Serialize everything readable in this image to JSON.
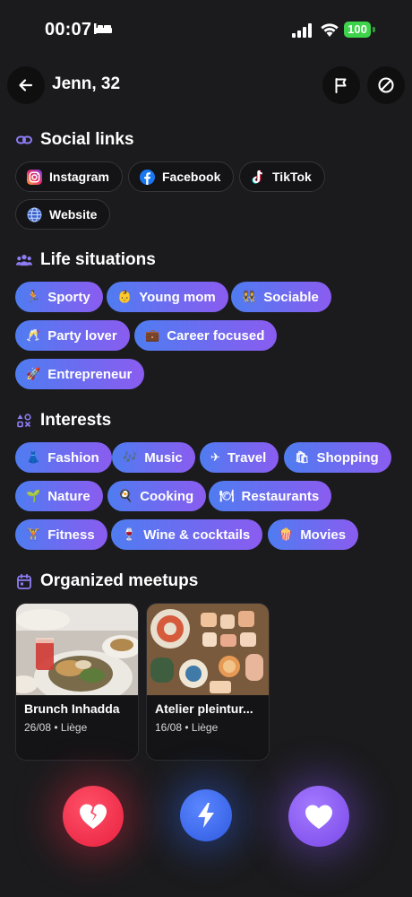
{
  "status_bar": {
    "time": "00:07",
    "battery": "100"
  },
  "header": {
    "title": "Jenn, 32"
  },
  "social_links": {
    "title": "Social links",
    "items": [
      {
        "label": "Instagram",
        "icon": "instagram-icon"
      },
      {
        "label": "Facebook",
        "icon": "facebook-icon"
      },
      {
        "label": "TikTok",
        "icon": "tiktok-icon"
      },
      {
        "label": "Website",
        "icon": "globe-icon"
      }
    ]
  },
  "life_situations": {
    "title": "Life situations",
    "items": [
      {
        "emoji": "🏃",
        "label": "Sporty"
      },
      {
        "emoji": "👶",
        "label": "Young mom"
      },
      {
        "emoji": "👯",
        "label": "Sociable"
      },
      {
        "emoji": "🥂",
        "label": "Party lover"
      },
      {
        "emoji": "💼",
        "label": "Career focused"
      },
      {
        "emoji": "🚀",
        "label": "Entrepreneur"
      }
    ]
  },
  "interests": {
    "title": "Interests",
    "items": [
      {
        "emoji": "👗",
        "label": "Fashion"
      },
      {
        "emoji": "🎶",
        "label": "Music"
      },
      {
        "emoji": "✈",
        "label": "Travel"
      },
      {
        "emoji": "🛍",
        "label": "Shopping"
      },
      {
        "emoji": "🌱",
        "label": "Nature"
      },
      {
        "emoji": "🍳",
        "label": "Cooking"
      },
      {
        "emoji": "🍽",
        "label": "Restaurants"
      },
      {
        "emoji": "🏋",
        "label": "Fitness"
      },
      {
        "emoji": "🍷",
        "label": "Wine & cocktails"
      },
      {
        "emoji": "🍿",
        "label": "Movies"
      }
    ]
  },
  "meetups": {
    "title": "Organized meetups",
    "items": [
      {
        "title": "Brunch Inhadda",
        "subtitle": "26/08 • Liège"
      },
      {
        "title": "Atelier pleintur...",
        "subtitle": "16/08 • Liège"
      }
    ]
  },
  "colors": {
    "background": "#1b1b1d",
    "accent_start": "#4f7cf0",
    "accent_end": "#8a5cf0",
    "pass": "#e8203e",
    "boost": "#2f5ae0",
    "like": "#7a48e8",
    "section_icon": "#8e7cf5"
  }
}
